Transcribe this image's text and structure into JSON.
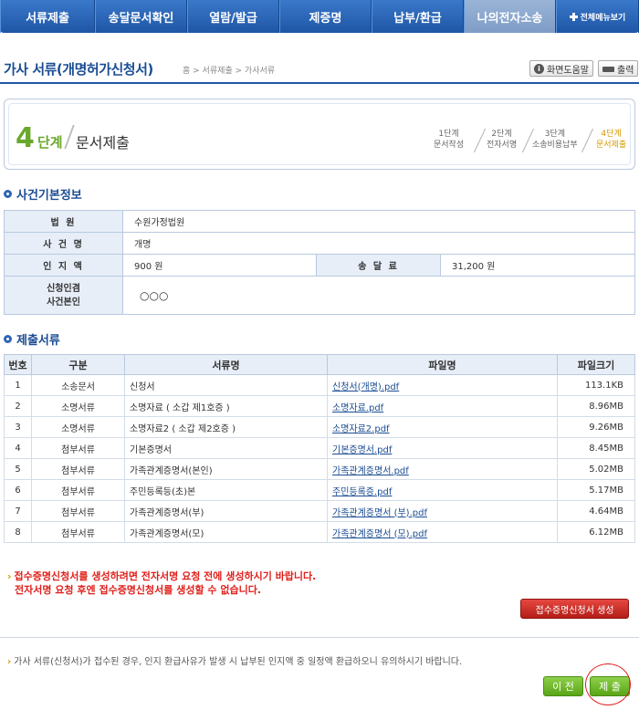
{
  "nav": {
    "items": [
      "서류제출",
      "송달문서확인",
      "열람/발급",
      "제증명",
      "납부/환급",
      "나의전자소송"
    ],
    "all_menu_label": "전체메뉴보기"
  },
  "header": {
    "title": "가사 서류(개명허가신청서)",
    "breadcrumb": "홈 > 서류제출 > 가사서류",
    "help_label": "화면도움말",
    "print_label": "출력"
  },
  "step": {
    "number": "4",
    "unit": "단계",
    "title": "문서제출",
    "steps": [
      {
        "no": "1단계",
        "name": "문서작성"
      },
      {
        "no": "2단계",
        "name": "전자서명"
      },
      {
        "no": "3단계",
        "name": "소송비용납부"
      },
      {
        "no": "4단계",
        "name": "문서제출"
      }
    ]
  },
  "case_info": {
    "heading": "사건기본정보",
    "court_label": "법 원",
    "court_value": "수원가정법원",
    "case_name_label": "사 건 명",
    "case_name_value": "개명",
    "stamp_label": "인 지 액",
    "stamp_value": "900 원",
    "service_label": "송 달 료",
    "service_value": "31,200 원",
    "applicant_label_1": "신청인겸",
    "applicant_label_2": "사건본인",
    "applicant_value": "○○○"
  },
  "documents": {
    "heading": "제출서류",
    "columns": [
      "번호",
      "구분",
      "서류명",
      "파일명",
      "파일크기"
    ],
    "rows": [
      [
        "1",
        "소송문서",
        "신청서",
        "신청서(개명).pdf",
        "113.1KB"
      ],
      [
        "2",
        "소명서류",
        "소명자료 ( 소갑 제1호증 )",
        "소명자료.pdf",
        "8.96MB"
      ],
      [
        "3",
        "소명서류",
        "소명자료2 ( 소갑 제2호증 )",
        "소명자료2.pdf",
        "9.26MB"
      ],
      [
        "4",
        "첨부서류",
        "기본증명서",
        "기본증명서.pdf",
        "8.45MB"
      ],
      [
        "5",
        "첨부서류",
        "가족관계증명서(본인)",
        "가족관계증명서.pdf",
        "5.02MB"
      ],
      [
        "6",
        "첨부서류",
        "주민등록등(초)본",
        "주민등록증.pdf",
        "5.17MB"
      ],
      [
        "7",
        "첨부서류",
        "가족관계증명서(부)",
        "가족관계증명서 (부).pdf",
        "4.64MB"
      ],
      [
        "8",
        "첨부서류",
        "가족관계증명서(모)",
        "가족관계증명서 (모).pdf",
        "6.12MB"
      ]
    ]
  },
  "warning": {
    "line1": "접수증명신청서를 생성하려면 전자서명 요청 전에 생성하시기 바랍니다.",
    "line2": "전자서명 요청 후엔 접수증명신청서를 생성할 수 없습니다."
  },
  "receipt_button": "접수증명신청서 생성",
  "notice": "가사 서류(신청서)가 접수된 경우, 인지 환급사유가 발생 시 납부된 인지액 중 일정액 환급하오니 유의하시기 바랍니다.",
  "buttons": {
    "prev": "이 전",
    "submit": "제 출"
  }
}
